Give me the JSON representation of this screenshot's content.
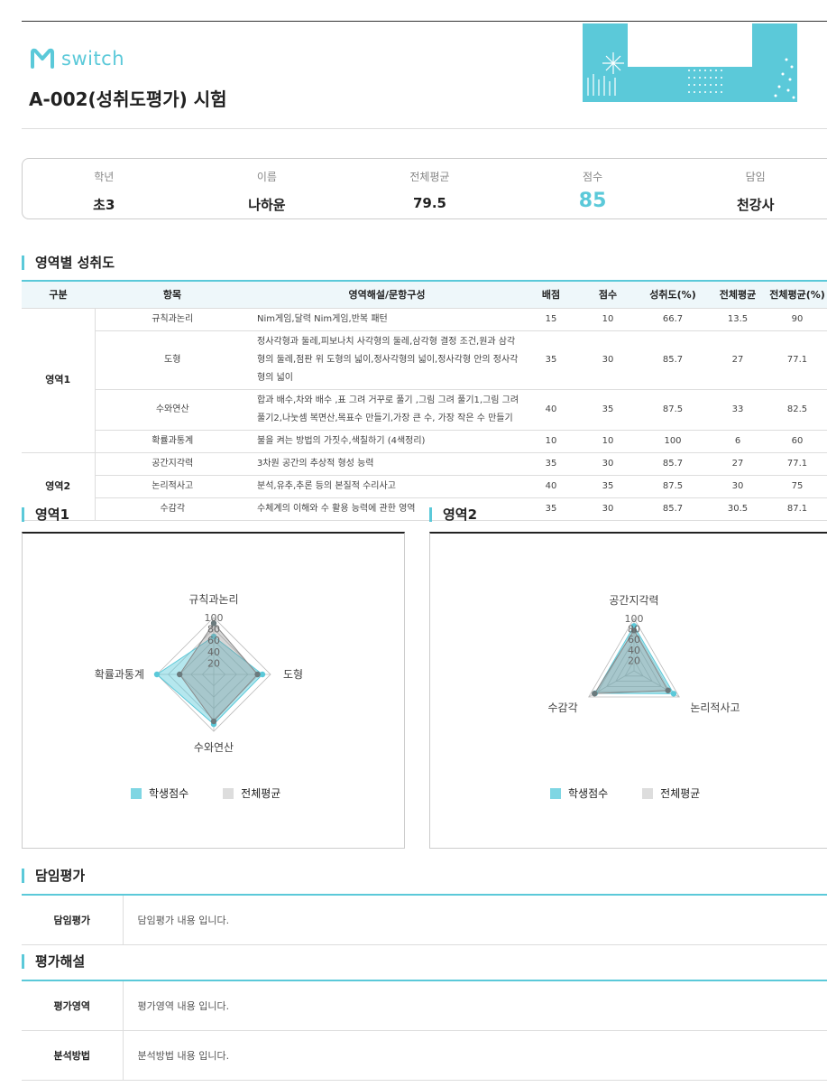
{
  "brand": {
    "name": "switch",
    "accent": "#5bc9d9"
  },
  "exam_title": "A-002(성취도평가) 시험",
  "info": [
    {
      "label": "학년",
      "value": "초3"
    },
    {
      "label": "이름",
      "value": "나하윤"
    },
    {
      "label": "전체평균",
      "value": "79.5"
    },
    {
      "label": "점수",
      "value": "85"
    },
    {
      "label": "담임",
      "value": "천강사"
    }
  ],
  "sections": {
    "achievement": "영역별 성취도",
    "area1": "영역1",
    "area2": "영역2",
    "teacher_eval": "담임평가",
    "interpretation": "평가해설"
  },
  "table": {
    "headers": [
      "구분",
      "항목",
      "영역해설/문항구성",
      "배점",
      "점수",
      "성취도(%)",
      "전체평균",
      "전체평균(%)"
    ],
    "groups": [
      {
        "area": "영역1",
        "rows": [
          {
            "item": "규칙과논리",
            "desc": "Nim게임,달력 Nim게임,반복 패턴",
            "points": "15",
            "score": "10",
            "pct": "66.7",
            "avg": "13.5",
            "avg_pct": "90"
          },
          {
            "item": "도형",
            "desc": "정사각형과 둘레,피보나치 사각형의 둘레,삼각형 결정 조건,원과 삼각형의 둘레,점판 위 도형의 넓이,정사각형의 넓이,정사각형 안의 정사각형의 넓이",
            "points": "35",
            "score": "30",
            "pct": "85.7",
            "avg": "27",
            "avg_pct": "77.1"
          },
          {
            "item": "수와연산",
            "desc": "합과 배수,차와 배수 ,표 그려 거꾸로 풀기 ,그림 그려 풀기1,그림 그려 풀기2,나눗셈 복면산,목표수 만들기,가장 큰 수, 가장 작은 수 만들기",
            "points": "40",
            "score": "35",
            "pct": "87.5",
            "avg": "33",
            "avg_pct": "82.5"
          },
          {
            "item": "확률과통계",
            "desc": "불을 켜는 방법의 가짓수,색칠하기 (4색정리)",
            "points": "10",
            "score": "10",
            "pct": "100",
            "avg": "6",
            "avg_pct": "60"
          }
        ]
      },
      {
        "area": "영역2",
        "rows": [
          {
            "item": "공간지각력",
            "desc": "3차원 공간의 추상적 형성 능력",
            "points": "35",
            "score": "30",
            "pct": "85.7",
            "avg": "27",
            "avg_pct": "77.1"
          },
          {
            "item": "논리적사고",
            "desc": "분석,유추,추론 등의 본질적 수리사고",
            "points": "40",
            "score": "35",
            "pct": "87.5",
            "avg": "30",
            "avg_pct": "75"
          },
          {
            "item": "수감각",
            "desc": "수체계의 이해와 수 활용 능력에 관한 영역",
            "points": "35",
            "score": "30",
            "pct": "85.7",
            "avg": "30.5",
            "avg_pct": "87.1"
          }
        ]
      }
    ]
  },
  "chart_data": [
    {
      "type": "radar",
      "axes": [
        "규칙과논리",
        "도형",
        "수와연산",
        "확률과통계"
      ],
      "ticks": [
        "20",
        "40",
        "60",
        "80",
        "100"
      ],
      "range": [
        0,
        100
      ],
      "series": [
        {
          "name": "학생점수",
          "values": [
            66.7,
            85.7,
            87.5,
            100
          ],
          "color": "#5bc9d9"
        },
        {
          "name": "전체평균",
          "values": [
            90,
            77.1,
            82.5,
            60
          ],
          "color": "#999999"
        }
      ]
    },
    {
      "type": "radar",
      "axes": [
        "공간지각력",
        "논리적사고",
        "수감각"
      ],
      "ticks": [
        "20",
        "40",
        "60",
        "80",
        "100"
      ],
      "range": [
        0,
        100
      ],
      "series": [
        {
          "name": "학생점수",
          "values": [
            85.7,
            87.5,
            85.7
          ],
          "color": "#5bc9d9"
        },
        {
          "name": "전체평균",
          "values": [
            77.1,
            75,
            87.1
          ],
          "color": "#999999"
        }
      ]
    }
  ],
  "legend": {
    "student": "학생점수",
    "average": "전체평균"
  },
  "teacher_eval": {
    "label": "담임평가",
    "content": "담임평가 내용 입니다."
  },
  "interpretation": [
    {
      "label": "평가영역",
      "content": "평가영역 내용 입니다."
    },
    {
      "label": "분석방법",
      "content": "분석방법 내용 입니다."
    }
  ]
}
